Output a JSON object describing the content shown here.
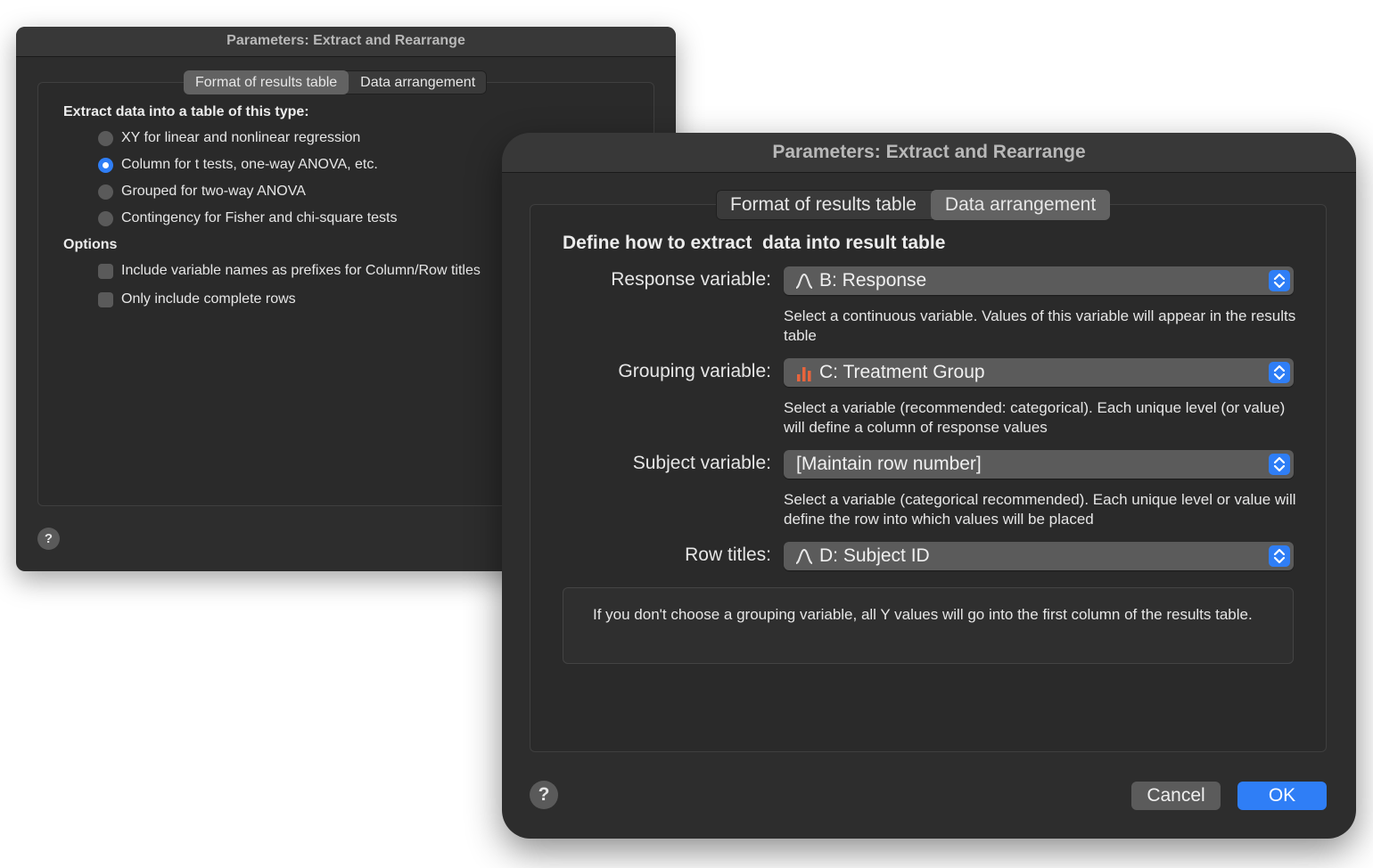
{
  "back_window": {
    "title": "Parameters: Extract and Rearrange",
    "tabs": [
      {
        "label": "Format of results table",
        "active": true
      },
      {
        "label": "Data arrangement",
        "active": false
      }
    ],
    "section_heading": "Extract data into a table of this type:",
    "radio_options": [
      {
        "label": "XY for linear and nonlinear regression",
        "checked": false
      },
      {
        "label": "Column for t tests, one-way ANOVA, etc.",
        "checked": true
      },
      {
        "label": "Grouped for two-way ANOVA",
        "checked": false
      },
      {
        "label": "Contingency for Fisher and chi-square tests",
        "checked": false
      }
    ],
    "options_heading": "Options",
    "checkbox_options": [
      {
        "label": "Include variable names as prefixes for Column/Row titles",
        "checked": false
      },
      {
        "label": "Only include complete rows",
        "checked": false
      }
    ],
    "help_label": "?"
  },
  "front_window": {
    "title": "Parameters: Extract and Rearrange",
    "tabs": [
      {
        "label": "Format of results table",
        "active": false
      },
      {
        "label": "Data arrangement",
        "active": true
      }
    ],
    "heading": "Define how to extract  data into result table",
    "fields": [
      {
        "label": "Response variable:",
        "value": "B: Response",
        "icon": "continuous-variable-icon",
        "hint": "Select a continuous variable. Values of this variable will appear in the results table"
      },
      {
        "label": "Grouping variable:",
        "value": "C: Treatment Group",
        "icon": "categorical-variable-icon",
        "hint": "Select a variable (recommended: categorical). Each unique level (or value) will define a column of response values"
      },
      {
        "label": "Subject variable:",
        "value": "[Maintain row number]",
        "icon": "",
        "hint": "Select a variable (categorical recommended). Each unique level or value will define the row into which values will be placed"
      },
      {
        "label": "Row titles:",
        "value": "D: Subject ID",
        "icon": "continuous-variable-icon",
        "hint": ""
      }
    ],
    "note": "If you don't choose a grouping variable, all Y values will go into the first column of the results table.",
    "help_label": "?",
    "cancel_label": "Cancel",
    "ok_label": "OK"
  },
  "colors": {
    "window_bg": "#2d2d2d",
    "accent_blue": "#2f7ef6",
    "categorical_icon": "#e8643c"
  }
}
